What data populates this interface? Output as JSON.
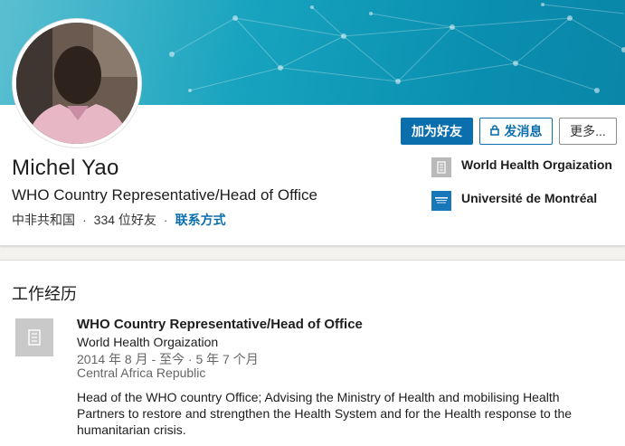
{
  "profile": {
    "name": "Michel Yao",
    "headline": "WHO Country Representative/Head of Office",
    "location": "中非共和国",
    "connections": "334 位好友",
    "contact_info": "联系方式",
    "separator": "·"
  },
  "actions": {
    "connect_label": "加为好友",
    "message_label": "发消息",
    "more_label": "更多..."
  },
  "orgs": [
    {
      "name": "World Health Orgaization",
      "icon": "building-icon"
    },
    {
      "name": "Université de Montréal",
      "icon": "university-logo-icon"
    }
  ],
  "experience": {
    "section_title": "工作经历",
    "items": [
      {
        "title": "WHO Country Representative/Head of Office",
        "company": "World Health Orgaization",
        "dates": "2014 年 8 月 - 至今 · 5 年 7 个月",
        "location": "Central Africa Republic",
        "description": "Head of the WHO country Office; Advising the Ministry of Health and mobilising Health Partners to restore and strengthen the Health System and for the Health response to the humanitarian crisis."
      }
    ]
  },
  "colors": {
    "accent": "#0b6fae",
    "banner": "#17a3be"
  }
}
